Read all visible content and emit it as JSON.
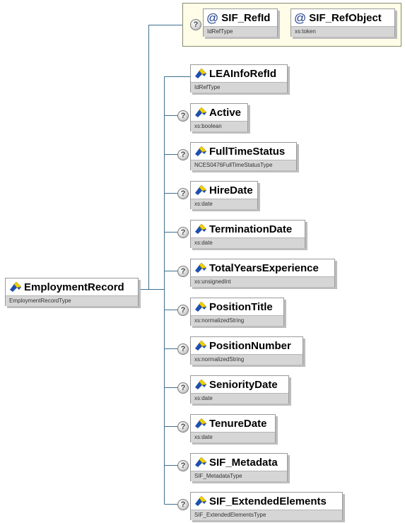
{
  "root": {
    "name": "EmploymentRecord",
    "type": "EmploymentRecordType"
  },
  "attributes": [
    {
      "name": "SIF_RefId",
      "type": "IdRefType"
    },
    {
      "name": "SIF_RefObject",
      "type": "xs:token"
    }
  ],
  "elements": [
    {
      "name": "LEAInfoRefId",
      "type": "IdRefType"
    },
    {
      "name": "Active",
      "type": "xs:boolean"
    },
    {
      "name": "FullTimeStatus",
      "type": "NCES0476FullTimeStatusType"
    },
    {
      "name": "HireDate",
      "type": "xs:date"
    },
    {
      "name": "TerminationDate",
      "type": "xs:date"
    },
    {
      "name": "TotalYearsExperience",
      "type": "xs:unsignedInt"
    },
    {
      "name": "PositionTitle",
      "type": "xs:normalizedString"
    },
    {
      "name": "PositionNumber",
      "type": "xs:normalizedString"
    },
    {
      "name": "SeniorityDate",
      "type": "xs:date"
    },
    {
      "name": "TenureDate",
      "type": "xs:date"
    },
    {
      "name": "SIF_Metadata",
      "type": "SIF_MetadataType"
    },
    {
      "name": "SIF_ExtendedElements",
      "type": "SIF_ExtendedElementsType"
    }
  ],
  "help_symbol": "?",
  "attribute_symbol": "@",
  "colors": {
    "connector": "#3f6f8f",
    "attr_group_bg": "#fffde8",
    "type_bar": "#d6d6d6",
    "icon_yellow": "#f2d000",
    "icon_blue": "#1f4fae"
  }
}
